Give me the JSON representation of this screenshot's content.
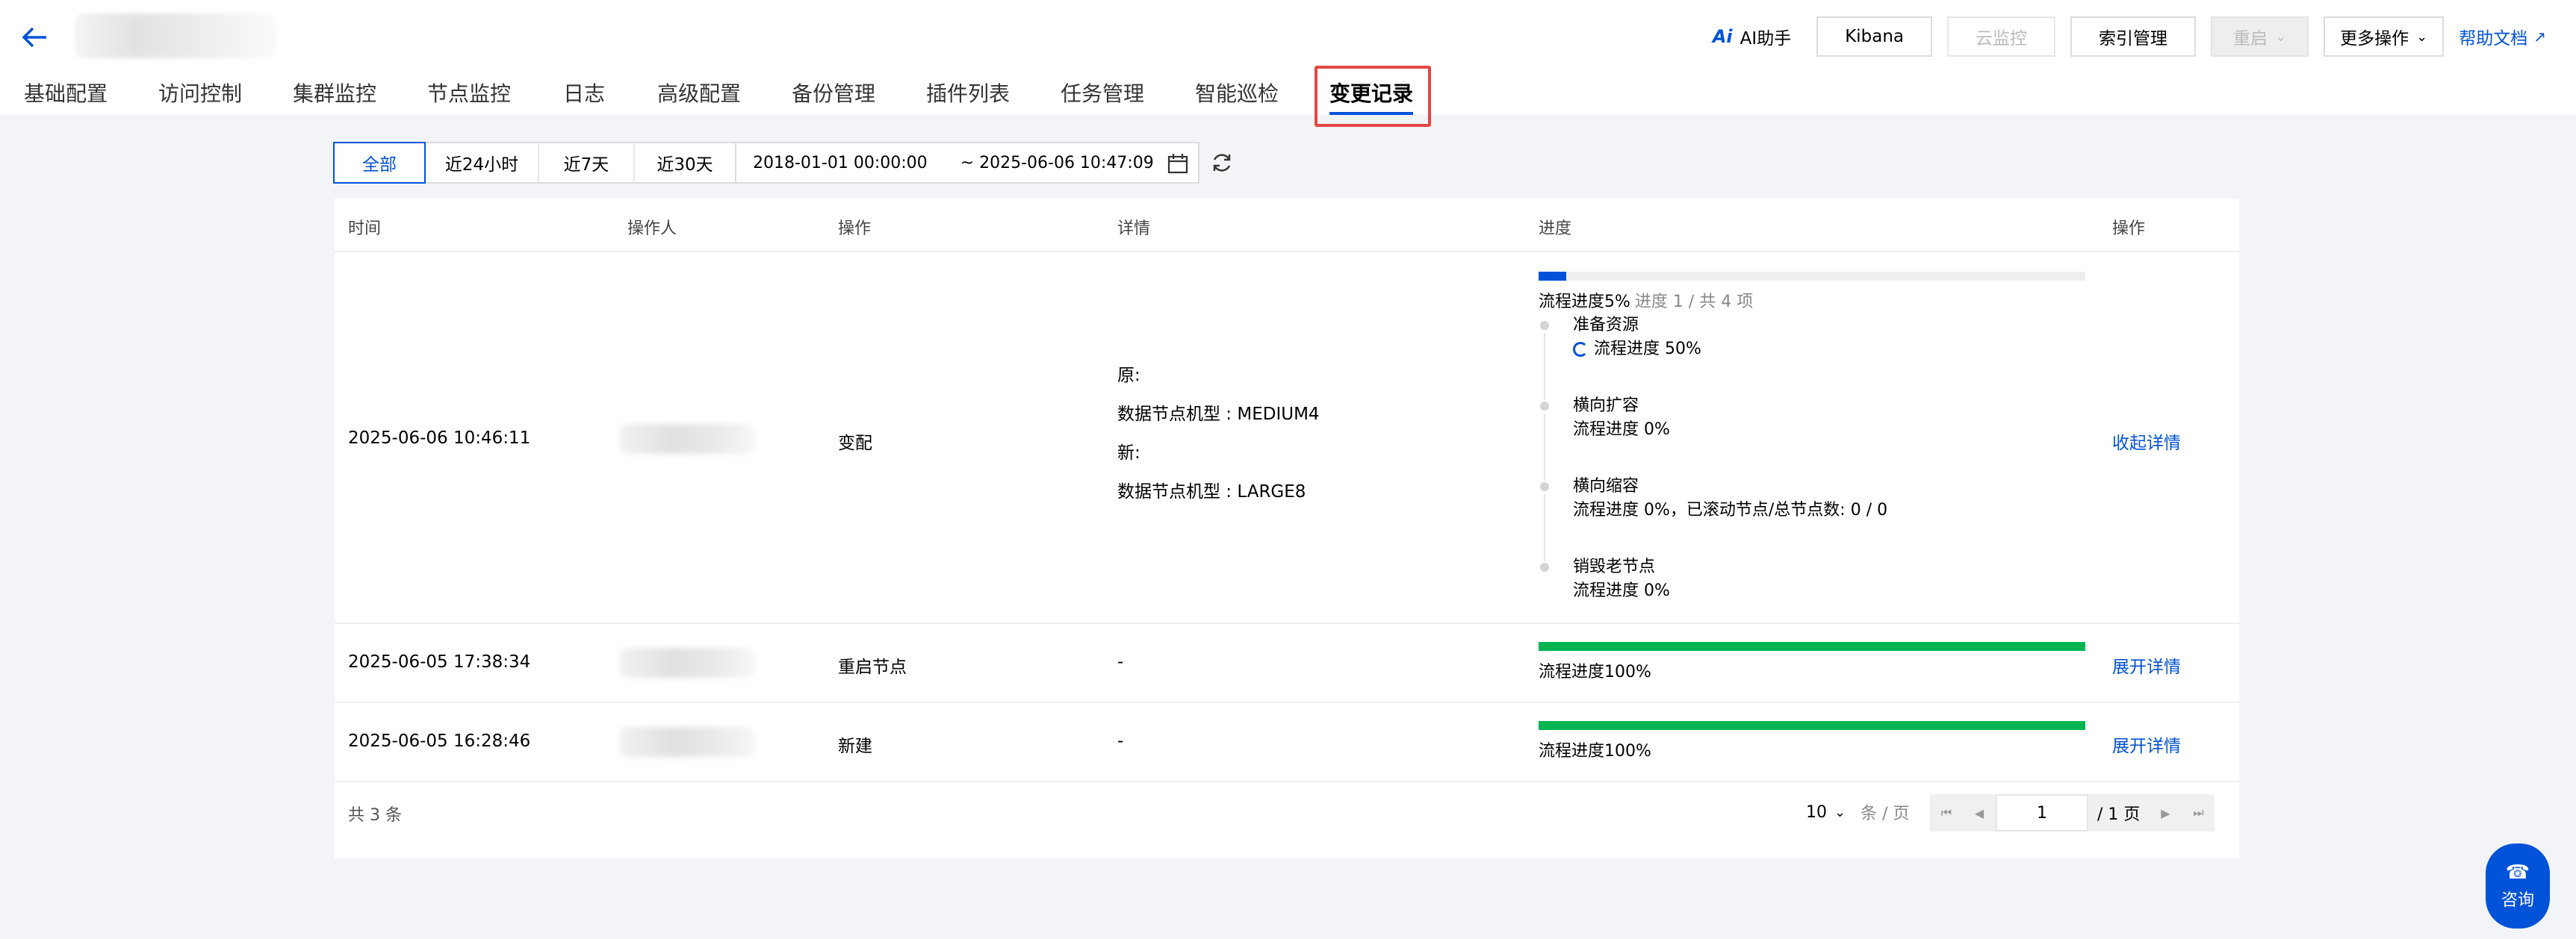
{
  "header": {
    "ai_label": "AI助手",
    "buttons": [
      {
        "label": "Kibana",
        "disabled": false
      },
      {
        "label": "云监控",
        "disabled": true
      },
      {
        "label": "索引管理",
        "disabled": false
      }
    ],
    "restart_label": "重启",
    "more_label": "更多操作",
    "help_label": "帮助文档"
  },
  "tabs": [
    {
      "label": "基础配置",
      "active": false
    },
    {
      "label": "访问控制",
      "active": false
    },
    {
      "label": "集群监控",
      "active": false
    },
    {
      "label": "节点监控",
      "active": false
    },
    {
      "label": "日志",
      "active": false
    },
    {
      "label": "高级配置",
      "active": false
    },
    {
      "label": "备份管理",
      "active": false
    },
    {
      "label": "插件列表",
      "active": false
    },
    {
      "label": "任务管理",
      "active": false
    },
    {
      "label": "智能巡检",
      "active": false
    },
    {
      "label": "变更记录",
      "active": true
    }
  ],
  "filters": {
    "ranges": [
      "全部",
      "近24小时",
      "近7天",
      "近30天"
    ],
    "active_index": 0,
    "start": "2018-01-01 00:00:00",
    "end": "~ 2025-06-06 10:47:09"
  },
  "table": {
    "columns": [
      "时间",
      "操作人",
      "操作",
      "详情",
      "进度",
      "操作"
    ],
    "rows": [
      {
        "time": "2025-06-06 10:46:11",
        "action": "变配",
        "details": [
          "原:",
          "数据节点机型 : MEDIUM4",
          "新:",
          "数据节点机型 : LARGE8"
        ],
        "progress_percent": 5,
        "progress_color": "#0052d9",
        "progress_text": "流程进度5%",
        "progress_sub": "进度 1 / 共 4 项",
        "steps": [
          {
            "title": "准备资源",
            "status": "流程进度 50%",
            "running": true
          },
          {
            "title": "横向扩容",
            "status": "流程进度 0%",
            "running": false
          },
          {
            "title": "横向缩容",
            "status": "流程进度 0%，已滚动节点/总节点数: 0 / 0",
            "running": false
          },
          {
            "title": "销毁老节点",
            "status": "流程进度 0%",
            "running": false
          }
        ],
        "op_link": "收起详情"
      },
      {
        "time": "2025-06-05 17:38:34",
        "action": "重启节点",
        "detail_text": "-",
        "progress_percent": 100,
        "progress_color": "#00b451",
        "progress_text": "流程进度100%",
        "op_link": "展开详情"
      },
      {
        "time": "2025-06-05 16:28:46",
        "action": "新建",
        "detail_text": "-",
        "progress_percent": 100,
        "progress_color": "#00b451",
        "progress_text": "流程进度100%",
        "op_link": "展开详情"
      }
    ]
  },
  "footer": {
    "total": "共 3 条",
    "page_size": "10",
    "page_size_unit": "条 / 页",
    "current_page": "1",
    "total_pages": "/ 1 页"
  },
  "consult_label": "咨询"
}
